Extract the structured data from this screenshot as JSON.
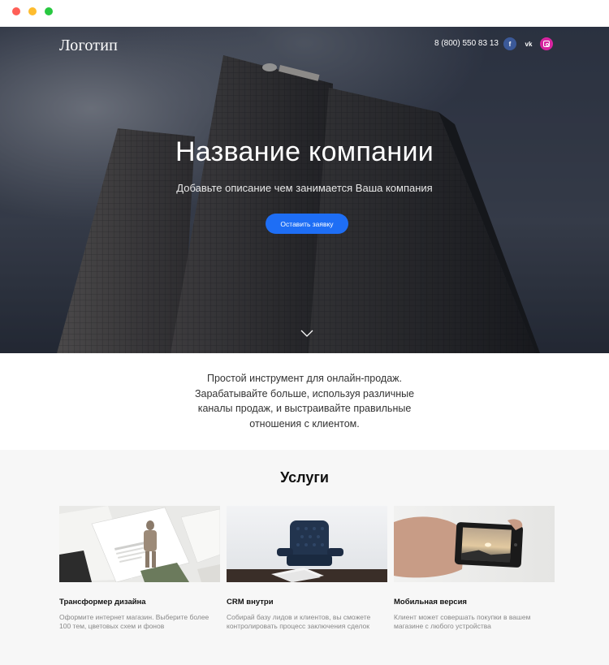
{
  "header": {
    "logo": "Логотип",
    "phone": "8 (800) 550 83 13",
    "social": [
      {
        "name": "facebook",
        "icon": "facebook-icon",
        "glyph": "f"
      },
      {
        "name": "vk",
        "icon": "vk-icon",
        "glyph": "vk"
      },
      {
        "name": "instagram",
        "icon": "instagram-icon"
      }
    ]
  },
  "hero": {
    "title": "Название компании",
    "subtitle": "Добавьте описание чем занимается Ваша компания",
    "button": "Оставить заявку",
    "scroll_icon": "chevron-down-icon"
  },
  "intro": {
    "text": "Простой инструмент для онлайн-продаж. Зарабатывайте больше, используя различные каналы продаж, и выстраивайте правильные отношения с клиентом."
  },
  "services": {
    "title": "Услуги",
    "cards": [
      {
        "title": "Трансформер дизайна",
        "text": "Оформите интернет магазин. Выберите более 100 тем, цветовых схем и фонов"
      },
      {
        "title": "CRM внутри",
        "text": "Собирай базу лидов и клиентов, вы сможете контролировать процесс заключения сделок"
      },
      {
        "title": "Мобильная версия",
        "text": "Клиент может совершать покупки в вашем магазине с любого устройства"
      }
    ]
  },
  "colors": {
    "accent": "#1e6ef5",
    "facebook": "#3b5998",
    "instagram": "#d6249f",
    "services_bg": "#f7f7f7"
  }
}
